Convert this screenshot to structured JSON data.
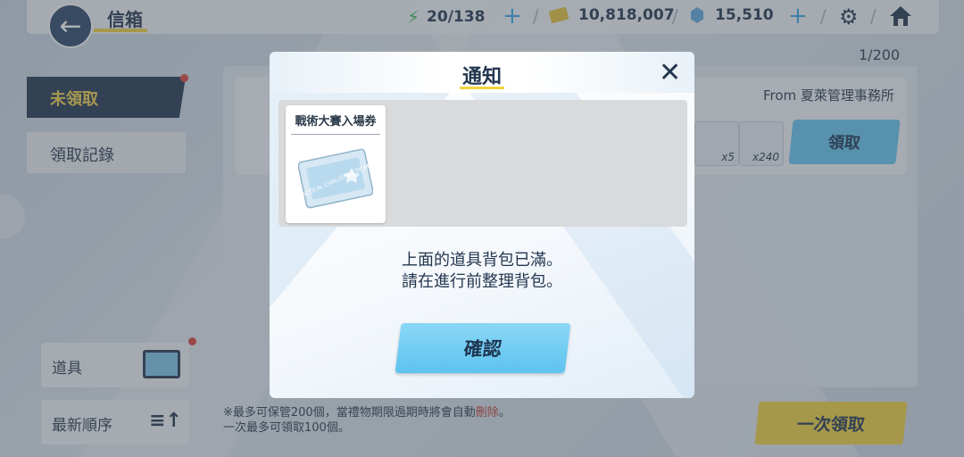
{
  "header": {
    "title": "信箱",
    "ap": "20/138",
    "credits": "10,818,007",
    "pyroxene": "15,510"
  },
  "mail_counter": "1/200",
  "sidebar": {
    "items": [
      {
        "label": "未領取"
      },
      {
        "label": "領取記錄"
      }
    ]
  },
  "mail": {
    "from": "From 夏萊管理事務所",
    "items": [
      {
        "qty": "x5"
      },
      {
        "qty": "x240"
      }
    ],
    "claim_label": "領取"
  },
  "bottom": {
    "items_label": "道具",
    "sort_label": "最新順序",
    "note_line1": "※最多可保管200個，當禮物期限過期時將會自動",
    "note_delete": "刪除",
    "note_period": "。",
    "note_line2": "一次最多可領取100個。",
    "claim_all_label": "一次領取"
  },
  "modal": {
    "title": "通知",
    "item_name": "戰術大賽入場券",
    "ticket_text": "TACTICAL CHALLENGE TICKET",
    "message_line1": "上面的道具背包已滿。",
    "message_line2": "請在進行前整理背包。",
    "confirm_label": "確認"
  },
  "colors": {
    "navy": "#23364f",
    "accent_yellow": "#f2d43c",
    "accent_blue": "#65c7f0",
    "alert_red": "#e0443a"
  }
}
